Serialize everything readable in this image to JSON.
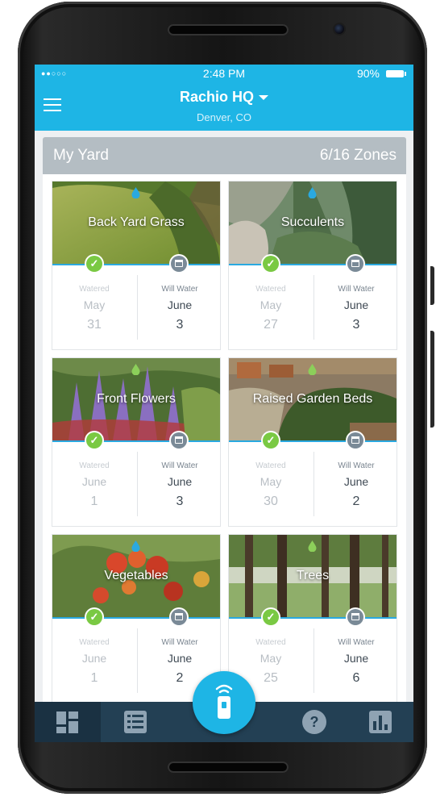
{
  "status_bar": {
    "signal": "●●○○○",
    "time": "2:48 PM",
    "battery": "90%"
  },
  "header": {
    "title": "Rachio HQ",
    "subtitle": "Denver, CO",
    "menu_icon": "hamburger-menu-icon"
  },
  "yard": {
    "title": "My Yard",
    "zones_count": "6/16 Zones"
  },
  "zones": [
    {
      "name": "Back Yard Grass",
      "drop_color": "#2aa9e0",
      "watered_label": "Watered",
      "watered_month": "May",
      "watered_day": "31",
      "will_label": "Will Water",
      "will_month": "June",
      "will_day": "3"
    },
    {
      "name": "Succulents",
      "drop_color": "#2aa9e0",
      "watered_label": "Watered",
      "watered_month": "May",
      "watered_day": "27",
      "will_label": "Will Water",
      "will_month": "June",
      "will_day": "3"
    },
    {
      "name": "Front Flowers",
      "drop_color": "#8ccf5a",
      "watered_label": "Watered",
      "watered_month": "June",
      "watered_day": "1",
      "will_label": "Will Water",
      "will_month": "June",
      "will_day": "3"
    },
    {
      "name": "Raised Garden Beds",
      "drop_color": "#8ccf5a",
      "watered_label": "Watered",
      "watered_month": "May",
      "watered_day": "30",
      "will_label": "Will Water",
      "will_month": "June",
      "will_day": "2"
    },
    {
      "name": "Vegetables",
      "drop_color": "#2aa9e0",
      "watered_label": "Watered",
      "watered_month": "June",
      "watered_day": "1",
      "will_label": "Will Water",
      "will_month": "June",
      "will_day": "2"
    },
    {
      "name": "Trees",
      "drop_color": "#8ccf5a",
      "watered_label": "Watered",
      "watered_month": "May",
      "watered_day": "25",
      "will_label": "Will Water",
      "will_month": "June",
      "will_day": "6"
    }
  ],
  "bottom_nav": {
    "tabs": [
      "dashboard-icon",
      "list-icon",
      "remote-control-icon",
      "help-icon",
      "bar-chart-icon"
    ],
    "active": "dashboard-icon"
  },
  "colors": {
    "primary": "#1eb5e5",
    "nav": "#234054",
    "watered_check": "#7ac943",
    "schedule_badge": "#7a8a97"
  }
}
